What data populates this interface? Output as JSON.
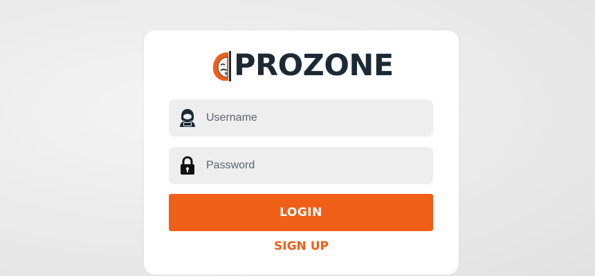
{
  "brand": {
    "name": "PROZONE",
    "logo_icon": "masked-hacker-logo",
    "text_color": "#1c2a36",
    "accent_color": "#ef5f17"
  },
  "form": {
    "username": {
      "placeholder": "Username",
      "value": "",
      "icon": "hooded-user-icon"
    },
    "password": {
      "placeholder": "Password",
      "value": "",
      "icon": "lock-icon"
    },
    "login_label": "LOGIN",
    "signup_label": "SIGN UP"
  }
}
